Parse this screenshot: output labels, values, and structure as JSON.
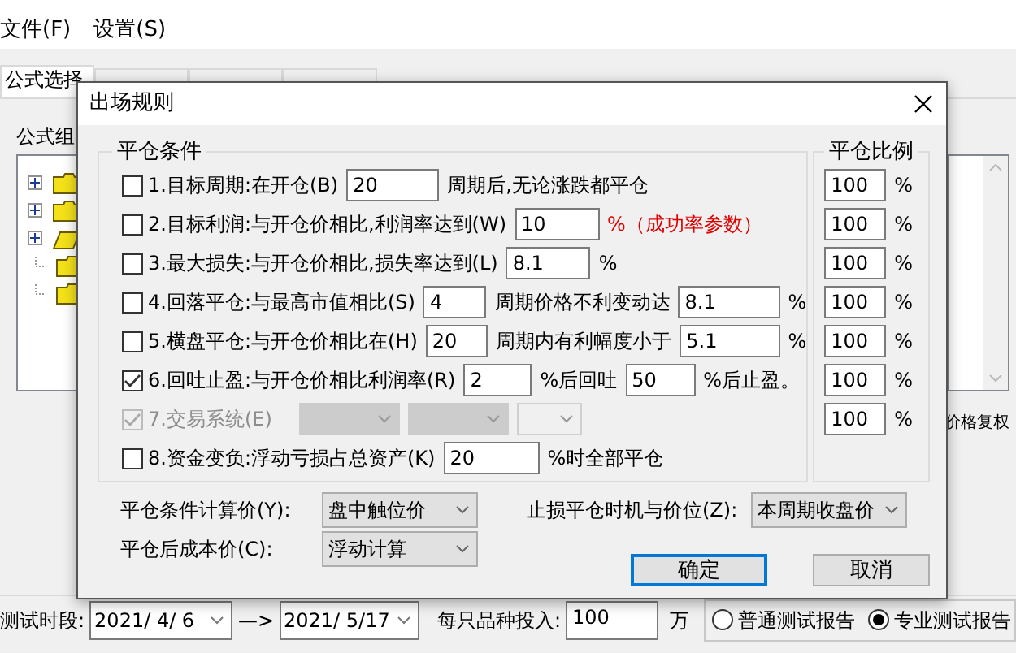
{
  "menu": [
    {
      "label": "文件(F)"
    },
    {
      "label": "设置(S)"
    }
  ],
  "tabs": [
    {
      "label": "公式选择",
      "selected": true
    },
    {
      "selected": false
    },
    {
      "selected": false
    },
    {
      "selected": false
    }
  ],
  "formula_panel": {
    "label": "公式组",
    "tree": [
      {
        "kind": "branch"
      },
      {
        "kind": "branch"
      },
      {
        "kind": "branch-open"
      },
      {
        "kind": "leaf"
      },
      {
        "kind": "leaf"
      }
    ]
  },
  "price_adjust_label": "价格复权",
  "bottom_bar": {
    "period_label": "测试时段:",
    "start_date": "2021/ 4/ 6",
    "arrow": "—>",
    "end_date": "2021/ 5/17",
    "invest_label": "每只品种投入:",
    "invest_value": "100",
    "invest_unit": "万",
    "report_types": [
      {
        "label": "普通测试报告",
        "selected": false
      },
      {
        "label": "专业测试报告",
        "selected": true
      }
    ]
  },
  "dialog": {
    "title": "出场规则",
    "conditions_title": "平仓条件",
    "ratio_title": "平仓比例",
    "conditions": [
      {
        "checked": false,
        "disabled": false,
        "label": "1.目标周期:在开仓(B)",
        "parts": [
          {
            "kind": "field",
            "value": "20"
          },
          {
            "kind": "text",
            "text": "周期后,无论涨跌都平仓",
            "alert": false
          }
        ]
      },
      {
        "checked": false,
        "disabled": false,
        "label": "2.目标利润:与开仓价相比,利润率达到(W)",
        "parts": [
          {
            "kind": "field",
            "value": "10"
          },
          {
            "kind": "text",
            "text": "%（成功率参数）",
            "alert": true
          }
        ]
      },
      {
        "checked": false,
        "disabled": false,
        "label": "3.最大损失:与开仓价相比,损失率达到(L)",
        "parts": [
          {
            "kind": "field",
            "value": "8.1"
          },
          {
            "kind": "text",
            "text": "%",
            "alert": false
          }
        ]
      },
      {
        "checked": false,
        "disabled": false,
        "label": "4.回落平仓:与最高市值相比(S)",
        "parts": [
          {
            "kind": "field",
            "value": "4"
          },
          {
            "kind": "text",
            "text": "周期价格不利变动达",
            "alert": false
          },
          {
            "kind": "field",
            "value": "8.1"
          },
          {
            "kind": "text",
            "text": "%",
            "alert": false
          }
        ]
      },
      {
        "checked": false,
        "disabled": false,
        "label": "5.横盘平仓:与开仓价相比在(H)",
        "parts": [
          {
            "kind": "field",
            "value": "20"
          },
          {
            "kind": "text",
            "text": "周期内有利幅度小于",
            "alert": false
          },
          {
            "kind": "field",
            "value": "5.1"
          },
          {
            "kind": "text",
            "text": "%",
            "alert": false
          }
        ]
      },
      {
        "checked": true,
        "disabled": false,
        "label": "6.回吐止盈:与开仓价相比利润率(R)",
        "parts": [
          {
            "kind": "field",
            "value": "2"
          },
          {
            "kind": "text",
            "text": "%后回吐",
            "alert": false
          },
          {
            "kind": "field",
            "value": "50"
          },
          {
            "kind": "text",
            "text": "%后止盈。",
            "alert": false
          }
        ]
      },
      {
        "checked": true,
        "disabled": true,
        "label": "7.交易系统(E)",
        "parts": [
          {
            "kind": "select"
          },
          {
            "kind": "select"
          },
          {
            "kind": "select"
          }
        ]
      },
      {
        "checked": false,
        "disabled": false,
        "label": "8.资金变负:浮动亏损占总资产(K)",
        "parts": [
          {
            "kind": "field",
            "value": "20"
          },
          {
            "kind": "text",
            "text": "%时全部平仓",
            "alert": false
          }
        ]
      }
    ],
    "ratios": [
      {
        "value": "100",
        "unit": "%"
      },
      {
        "value": "100",
        "unit": "%"
      },
      {
        "value": "100",
        "unit": "%"
      },
      {
        "value": "100",
        "unit": "%"
      },
      {
        "value": "100",
        "unit": "%"
      },
      {
        "value": "100",
        "unit": "%"
      },
      {
        "value": "100",
        "unit": "%"
      }
    ],
    "price_settings": [
      {
        "label": "平仓条件计算价(Y):",
        "value": "盘中触位价"
      },
      {
        "label": "平仓后成本价(C):",
        "value": "浮动计算"
      },
      {
        "label": "止损平仓时机与价位(Z):",
        "value": "本周期收盘价"
      }
    ],
    "buttons": [
      {
        "label": "确定",
        "focused": true
      },
      {
        "label": "取消",
        "focused": false
      }
    ]
  }
}
